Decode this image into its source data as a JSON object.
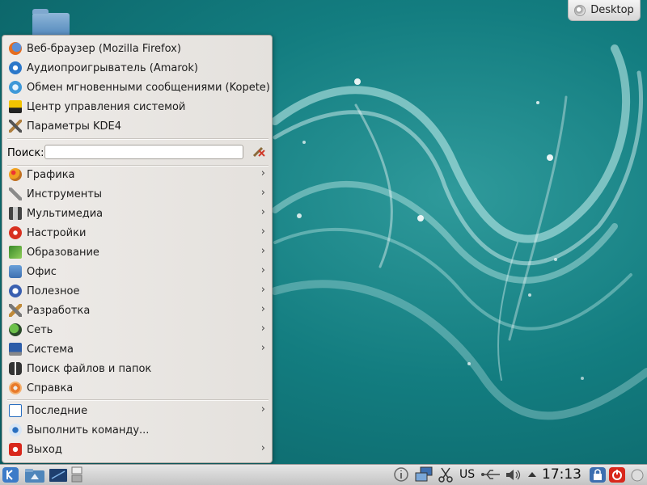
{
  "desktop": {
    "button_label": "Desktop"
  },
  "menu": {
    "favorites": [
      {
        "label": "Веб-браузер (Mozilla Firefox)",
        "icon": "firefox-icon"
      },
      {
        "label": "Аудиопроигрыватель (Amarok)",
        "icon": "amarok-icon"
      },
      {
        "label": "Обмен мгновенными сообщениями (Kopete)",
        "icon": "kopete-icon"
      },
      {
        "label": "Центр управления системой",
        "icon": "control-center-icon"
      },
      {
        "label": "Параметры KDE4",
        "icon": "tools-icon"
      }
    ],
    "search": {
      "label": "Поиск:",
      "value": ""
    },
    "categories": [
      {
        "label": "Графика",
        "icon": "graphics-icon"
      },
      {
        "label": "Инструменты",
        "icon": "wrench-icon"
      },
      {
        "label": "Мультимедиа",
        "icon": "multimedia-icon"
      },
      {
        "label": "Настройки",
        "icon": "settings-icon"
      },
      {
        "label": "Образование",
        "icon": "education-icon"
      },
      {
        "label": "Офис",
        "icon": "office-icon"
      },
      {
        "label": "Полезное",
        "icon": "utilities-icon"
      },
      {
        "label": "Разработка",
        "icon": "development-icon"
      },
      {
        "label": "Сеть",
        "icon": "network-icon"
      },
      {
        "label": "Система",
        "icon": "system-icon"
      }
    ],
    "actions": [
      {
        "label": "Поиск файлов и папок",
        "icon": "binoculars-icon"
      },
      {
        "label": "Справка",
        "icon": "help-lifebuoy-icon"
      }
    ],
    "bottom": [
      {
        "label": "Последние",
        "icon": "recent-icon"
      },
      {
        "label": "Выполнить команду...",
        "icon": "run-command-icon"
      },
      {
        "label": "Выход",
        "icon": "exit-icon"
      }
    ]
  },
  "panel": {
    "keyboard_layout": "US",
    "clock": "17:13"
  },
  "colors": {
    "wallpaper": "#137d80",
    "menu_bg": "#eae7e3",
    "panel_bg": "#d8d8d8"
  }
}
